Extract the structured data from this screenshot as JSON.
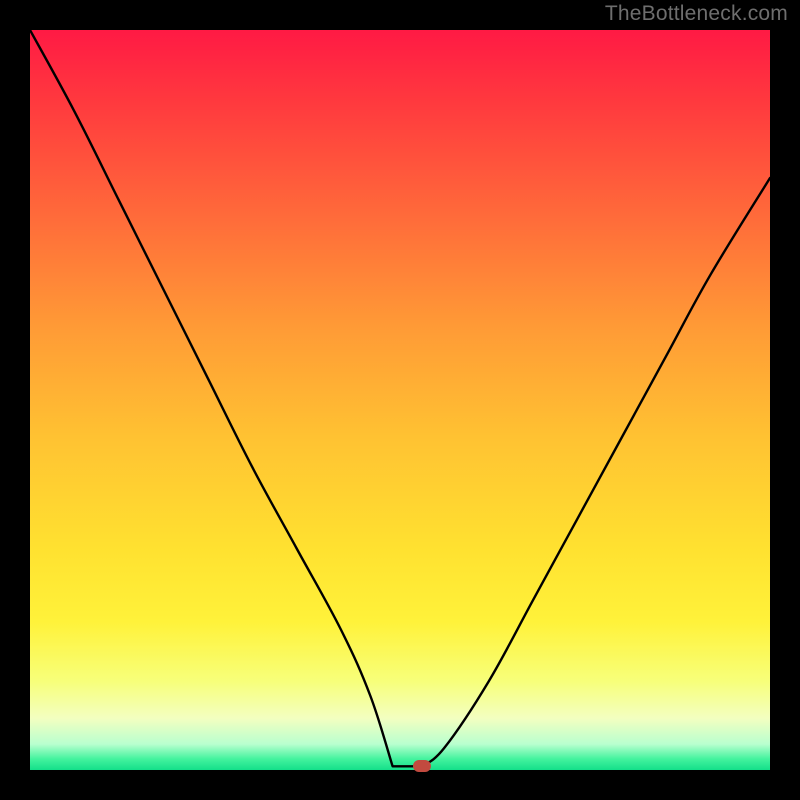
{
  "watermark": "TheBottleneck.com",
  "colors": {
    "marker": "#c24a3f",
    "curve": "#000000",
    "gradient_stops": [
      {
        "offset": 0.0,
        "color": "#ff1a44"
      },
      {
        "offset": 0.1,
        "color": "#ff3a3e"
      },
      {
        "offset": 0.25,
        "color": "#ff6a3a"
      },
      {
        "offset": 0.4,
        "color": "#ff9a36"
      },
      {
        "offset": 0.55,
        "color": "#ffc232"
      },
      {
        "offset": 0.7,
        "color": "#ffe130"
      },
      {
        "offset": 0.8,
        "color": "#fff23a"
      },
      {
        "offset": 0.88,
        "color": "#f7ff7a"
      },
      {
        "offset": 0.93,
        "color": "#f3ffc0"
      },
      {
        "offset": 0.965,
        "color": "#b9ffcf"
      },
      {
        "offset": 0.985,
        "color": "#44f39e"
      },
      {
        "offset": 1.0,
        "color": "#14df8a"
      }
    ]
  },
  "chart_data": {
    "type": "line",
    "title": "",
    "xlabel": "",
    "ylabel": "",
    "xlim": [
      0,
      100
    ],
    "ylim": [
      0,
      100
    ],
    "series": [
      {
        "name": "curve",
        "x": [
          0,
          6,
          12,
          18,
          24,
          30,
          36,
          42,
          46,
          49,
          51,
          53,
          56,
          62,
          68,
          74,
          80,
          86,
          92,
          100
        ],
        "y": [
          100,
          89,
          77,
          65,
          53,
          41,
          30,
          19,
          10,
          4,
          1,
          0,
          3,
          12,
          23,
          34,
          45,
          56,
          67,
          80
        ]
      }
    ],
    "marker": {
      "x": 53,
      "y": 0
    },
    "flat_min": {
      "x_start": 49,
      "x_end": 53,
      "y": 0.5
    }
  }
}
